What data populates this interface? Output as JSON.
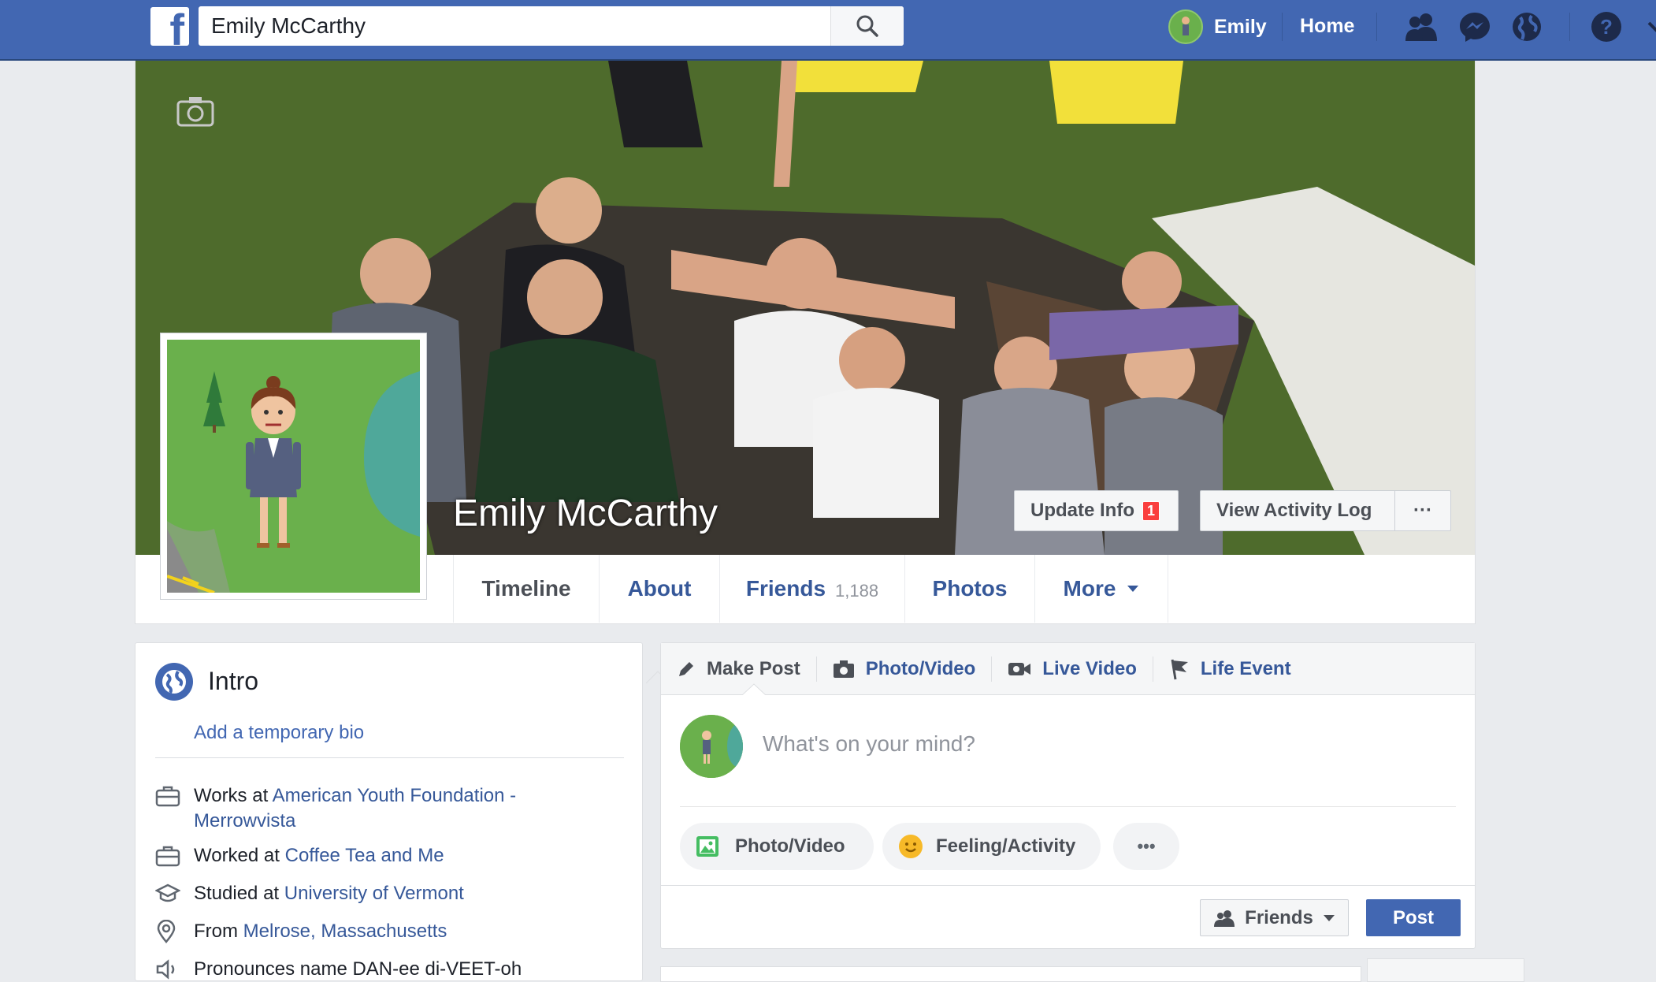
{
  "topbar": {
    "logo": "f",
    "search_value": "Emily McCarthy",
    "user_name": "Emily",
    "home_label": "Home",
    "icons": [
      "friend-requests-icon",
      "messenger-icon",
      "notifications-globe-icon",
      "help-icon"
    ]
  },
  "profile": {
    "name": "Emily McCarthy",
    "update_info_label": "Update Info",
    "update_info_badge": "1",
    "activity_log_label": "View Activity Log",
    "more_options": "···"
  },
  "tabs": {
    "timeline": "Timeline",
    "about": "About",
    "friends": "Friends",
    "friends_count": "1,188",
    "photos": "Photos",
    "more": "More"
  },
  "intro": {
    "title": "Intro",
    "bio_link": "Add a temporary bio",
    "work1_prefix": "Works at ",
    "work1_link": "American Youth Foundation -",
    "work1_link_cont": "Merrowvista",
    "work2_prefix": "Worked at ",
    "work2_link": "Coffee Tea and Me",
    "school_prefix": "Studied at ",
    "school_link": "University of Vermont",
    "from_prefix": "From ",
    "from_link": "Melrose, Massachusetts",
    "pronounce": "Pronounces name DAN-ee di-VEET-oh"
  },
  "composer": {
    "tabs": [
      "Make Post",
      "Photo/Video",
      "Live Video",
      "Life Event"
    ],
    "placeholder": "What's on your mind?",
    "photo_video": "Photo/Video",
    "feeling": "Feeling/Activity",
    "more": "•••",
    "audience": "Friends",
    "post": "Post"
  },
  "colors": {
    "brand": "#4267b2",
    "link": "#365899",
    "background": "#e9ebee",
    "badge": "#fa3e3e"
  }
}
